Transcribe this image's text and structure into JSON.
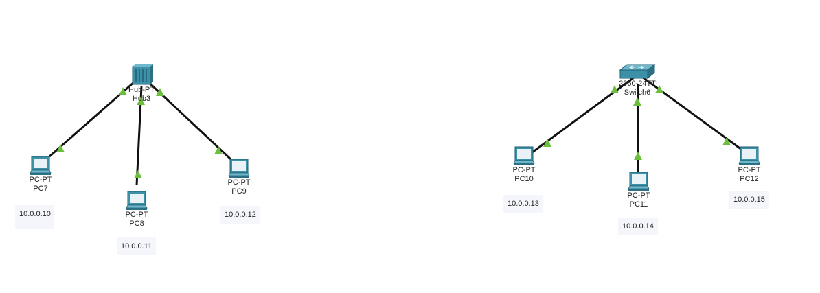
{
  "topology": {
    "devices": {
      "hub3": {
        "model": "Hub-PT",
        "name": "Hub3",
        "icon": "hub-icon"
      },
      "switch6": {
        "model": "2960-24TT",
        "name": "Switch6",
        "icon": "switch-icon"
      },
      "pc7": {
        "model": "PC-PT",
        "name": "PC7",
        "ip": "10.0.0.10",
        "icon": "pc-icon"
      },
      "pc8": {
        "model": "PC-PT",
        "name": "PC8",
        "ip": "10.0.0.11",
        "icon": "pc-icon"
      },
      "pc9": {
        "model": "PC-PT",
        "name": "PC9",
        "ip": "10.0.0.12",
        "icon": "pc-icon"
      },
      "pc10": {
        "model": "PC-PT",
        "name": "PC10",
        "ip": "10.0.0.13",
        "icon": "pc-icon"
      },
      "pc11": {
        "model": "PC-PT",
        "name": "PC11",
        "ip": "10.0.0.14",
        "icon": "pc-icon"
      },
      "pc12": {
        "model": "PC-PT",
        "name": "PC12",
        "ip": "10.0.0.15",
        "icon": "pc-icon"
      }
    },
    "links": [
      {
        "from": "hub3",
        "to": "pc7",
        "status": "up"
      },
      {
        "from": "hub3",
        "to": "pc8",
        "status": "up"
      },
      {
        "from": "hub3",
        "to": "pc9",
        "status": "up"
      },
      {
        "from": "switch6",
        "to": "pc10",
        "status": "up"
      },
      {
        "from": "switch6",
        "to": "pc11",
        "status": "up"
      },
      {
        "from": "switch6",
        "to": "pc12",
        "status": "up"
      }
    ],
    "colors": {
      "cable": "#111111",
      "link_up": "#6cbf3c",
      "device_teal": "#3c90a8",
      "ip_box": "#f4f6fc"
    }
  }
}
